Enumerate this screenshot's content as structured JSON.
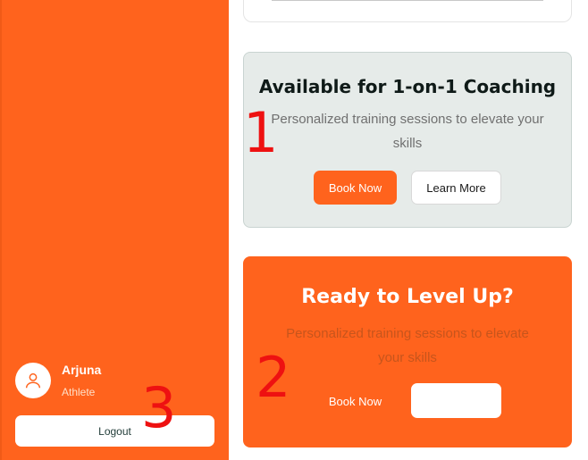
{
  "sidebar": {
    "user": {
      "name": "Arjuna",
      "role": "Athlete",
      "avatar_icon": "user-icon"
    },
    "logout_label": "Logout"
  },
  "cards": {
    "coaching": {
      "title": "Available for 1-on-1 Coaching",
      "description": "Personalized training sessions to elevate your skills",
      "primary_label": "Book Now",
      "secondary_label": "Learn More"
    },
    "level_up": {
      "title": "Ready to Level Up?",
      "description": "Personalized training sessions to elevate your skills",
      "primary_label": "Book Now",
      "secondary_label": ""
    }
  },
  "annotations": [
    "1",
    "2",
    "3"
  ],
  "colors": {
    "accent": "#ff631d",
    "card_bg": "#e6ebe9",
    "marker": "#ee1111"
  }
}
